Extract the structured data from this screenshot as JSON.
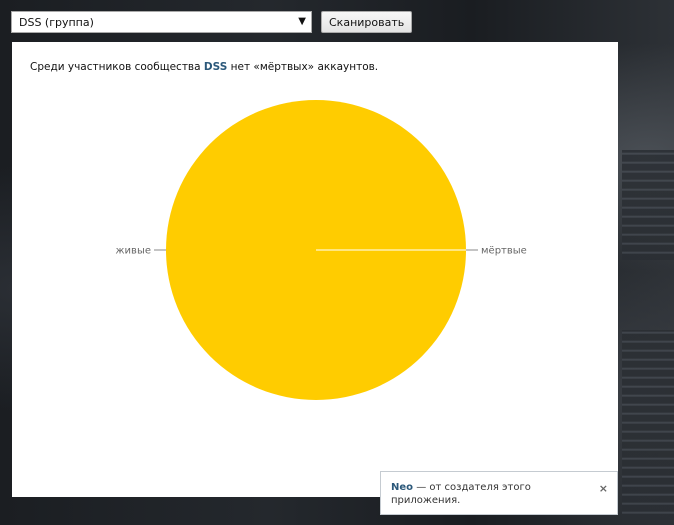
{
  "toolbar": {
    "group_select_value": "DSS (группа)",
    "scan_label": "Сканировать"
  },
  "summary": {
    "prefix": "Среди участников сообщества",
    "group_name": "DSS",
    "suffix": "нет «мёртвых» аккаунтов."
  },
  "chart_data": {
    "type": "pie",
    "labels": [
      "живые",
      "мёртвые"
    ],
    "values": [
      100,
      0
    ],
    "colors": [
      "#ffcc00",
      "#ffcc00"
    ],
    "title": ""
  },
  "notice": {
    "app_name": "Neo",
    "text": " — от создателя этого приложения.",
    "close_glyph": "×"
  }
}
